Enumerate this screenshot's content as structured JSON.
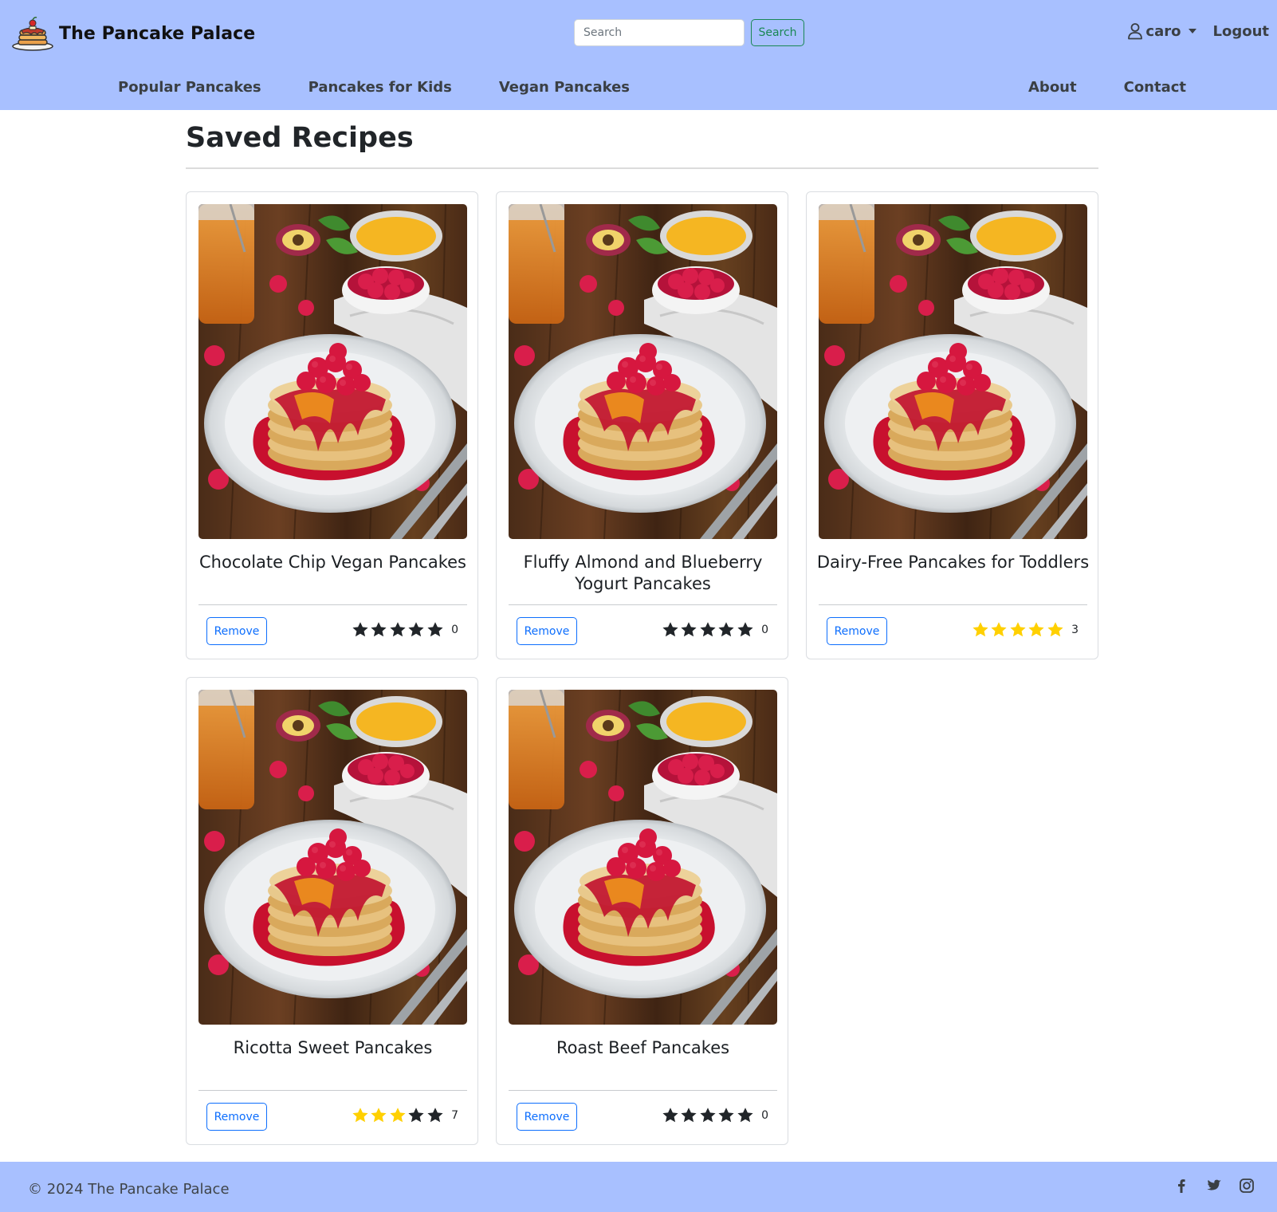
{
  "header": {
    "brand": "The Pancake Palace",
    "search_placeholder": "Search",
    "search_button": "Search",
    "username": "caro",
    "logout": "Logout",
    "nav_left": [
      "Popular Pancakes",
      "Pancakes for Kids",
      "Vegan Pancakes"
    ],
    "nav_right": [
      "About",
      "Contact"
    ]
  },
  "main": {
    "title": "Saved Recipes",
    "remove_label": "Remove",
    "recipes": [
      {
        "title": "Chocolate Chip Vegan Pancakes",
        "stars_filled": 0,
        "rating_count": "0"
      },
      {
        "title": "Fluffy Almond and Blueberry Yogurt Pancakes",
        "stars_filled": 0,
        "rating_count": "0"
      },
      {
        "title": "Dairy-Free Pancakes for Toddlers",
        "stars_filled": 5,
        "rating_count": "3"
      },
      {
        "title": "Ricotta Sweet Pancakes",
        "stars_filled": 3,
        "rating_count": "7"
      },
      {
        "title": "Roast Beef Pancakes",
        "stars_filled": 0,
        "rating_count": "0"
      }
    ]
  },
  "footer": {
    "copyright": "© 2024 The Pancake Palace",
    "social": [
      "facebook-icon",
      "twitter-icon",
      "instagram-icon"
    ]
  },
  "colors": {
    "header_bg": "#a8c0ff",
    "star_filled": "#ffd000",
    "star_empty": "#212529",
    "remove_button": "#0d6efd",
    "search_button": "#198754"
  }
}
